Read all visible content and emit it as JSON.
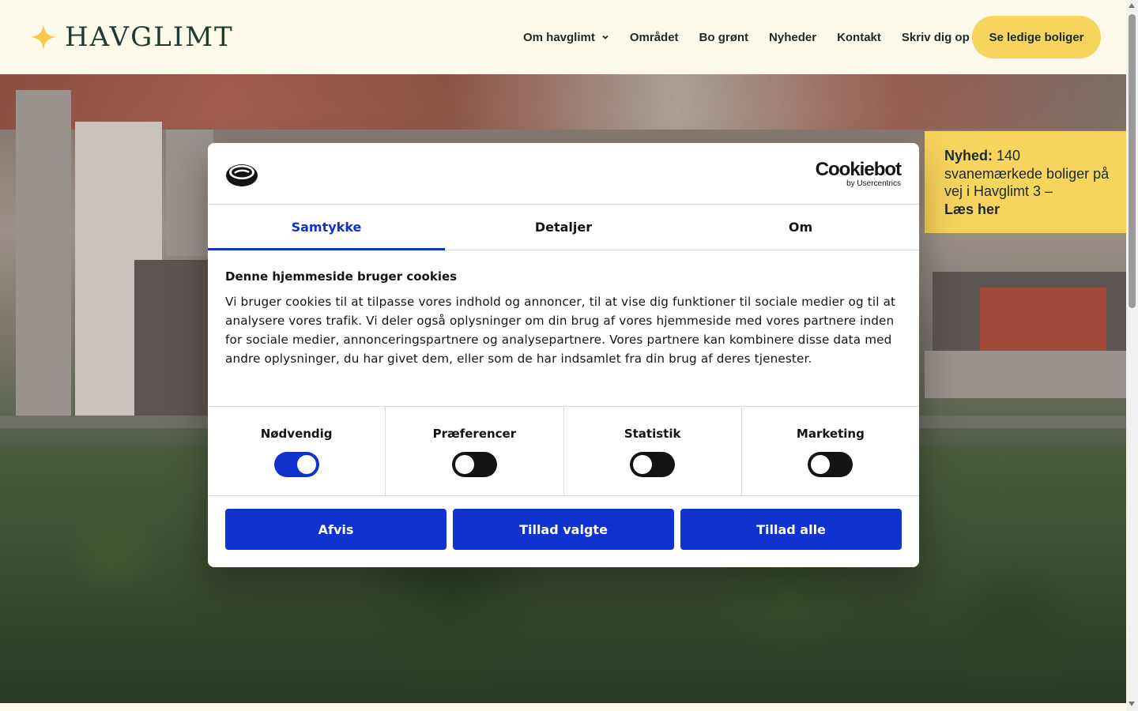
{
  "header": {
    "logo_text": "HAVGLIMT",
    "logo_icon": "star-icon",
    "nav": [
      {
        "label": "Om havglimt",
        "has_dropdown": true
      },
      {
        "label": "Området"
      },
      {
        "label": "Bo grønt"
      },
      {
        "label": "Nyheder"
      },
      {
        "label": "Kontakt"
      },
      {
        "label": "Skriv dig op"
      }
    ],
    "cta_label": "Se ledige boliger"
  },
  "news": {
    "prefix": "Nyhed:",
    "text": " 140 svanemærkede boliger på vej i Havglimt 3 –",
    "link": "Læs her"
  },
  "cookie_dialog": {
    "brand": "Cookiebot",
    "brand_by": "by Usercentrics",
    "tabs": [
      "Samtykke",
      "Detaljer",
      "Om"
    ],
    "active_tab": "Samtykke",
    "title": "Denne hjemmeside bruger cookies",
    "body": "Vi bruger cookies til at tilpasse vores indhold og annoncer, til at vise dig funktioner til sociale medier og til at analysere vores trafik. Vi deler også oplysninger om din brug af vores hjemmeside med vores partnere inden for sociale medier, annonceringspartnere og analysepartnere. Vores partnere kan kombinere disse data med andre oplysninger, du har givet dem, eller som de har indsamlet fra din brug af deres tjenester.",
    "consents": [
      {
        "label": "Nødvendig",
        "enabled": true
      },
      {
        "label": "Præferencer",
        "enabled": false
      },
      {
        "label": "Statistik",
        "enabled": false
      },
      {
        "label": "Marketing",
        "enabled": false
      }
    ],
    "buttons": [
      "Afvis",
      "Tillad valgte",
      "Tillad alle"
    ]
  },
  "colors": {
    "accent_blue": "#1032cf",
    "brand_yellow": "#f7d45d",
    "header_bg": "#fefae9",
    "logo_green": "#1d3a35"
  }
}
